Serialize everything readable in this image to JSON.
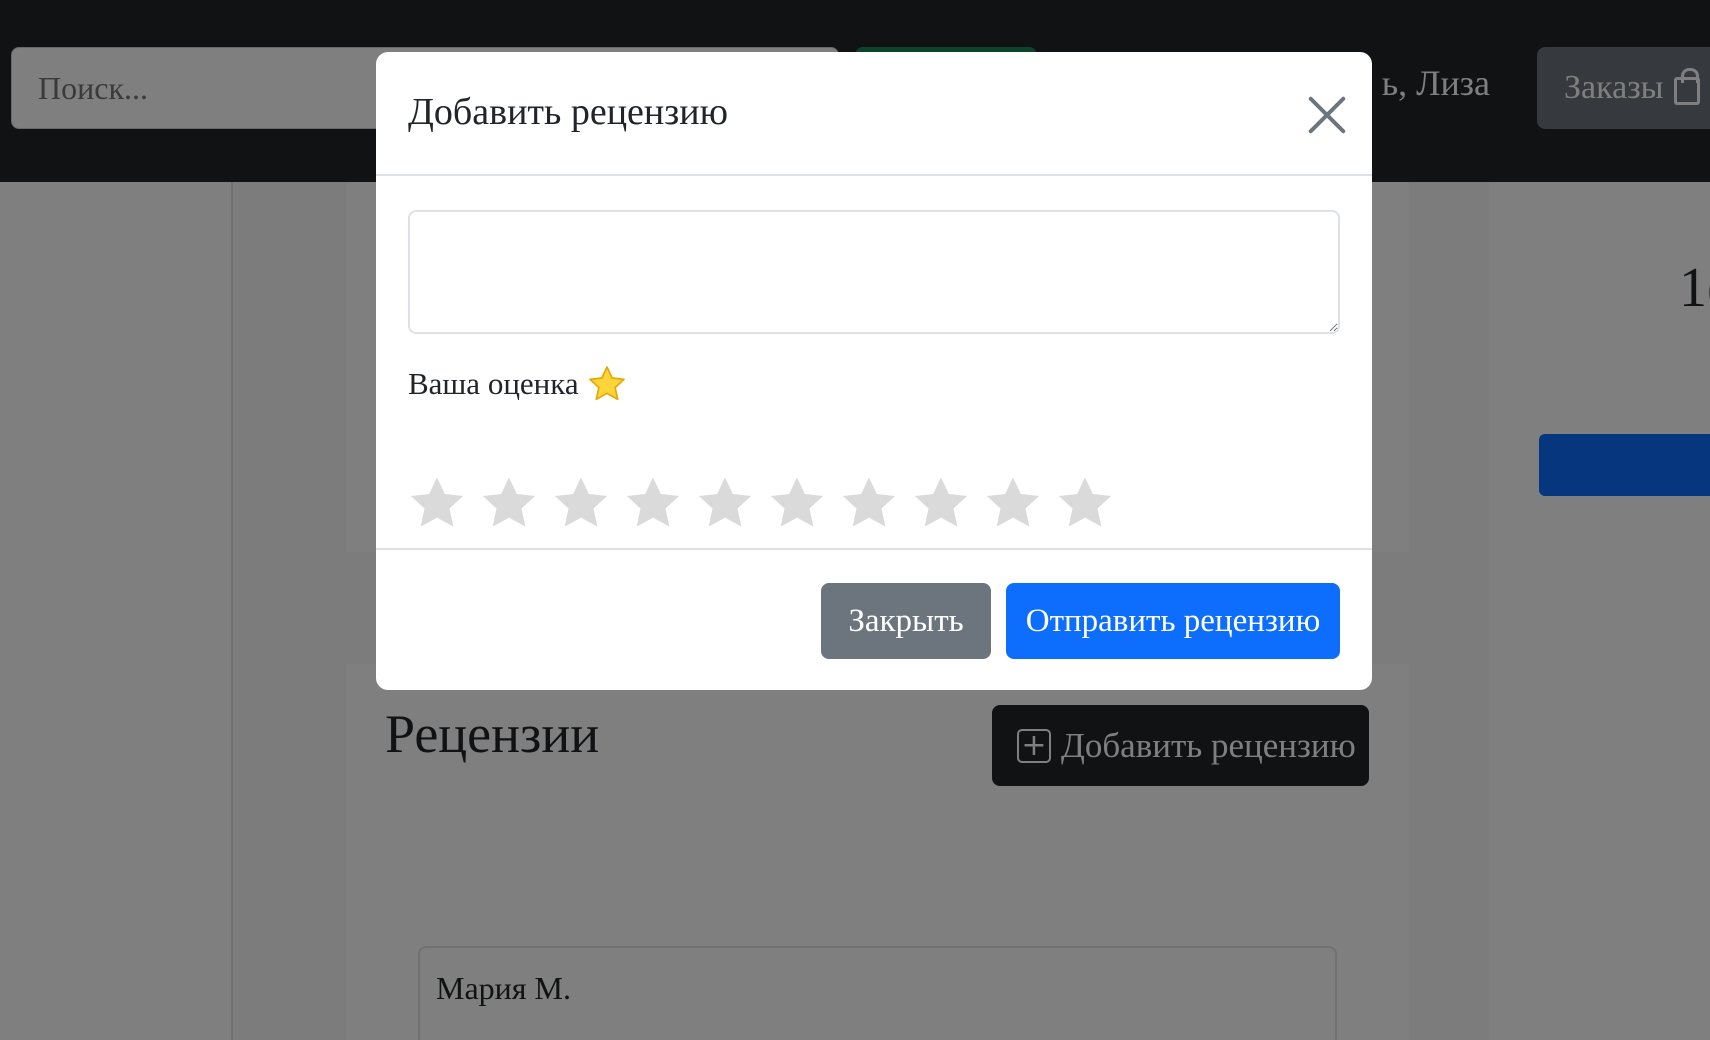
{
  "header": {
    "search_placeholder": "Поиск...",
    "greeting": "ь, Лиза",
    "orders_label": "Заказы"
  },
  "product": {
    "price_partial": "1("
  },
  "reviews": {
    "title": "Рецензии",
    "add_button_label": "Добавить рецензию",
    "items": [
      {
        "author": "Мария М."
      }
    ]
  },
  "modal": {
    "title": "Добавить рецензию",
    "textarea_value": "",
    "rating_label": "Ваша оценка",
    "rating_max": 10,
    "rating_value": 0,
    "star_color_empty": "#dadada",
    "close_label": "Закрыть",
    "submit_label": "Отправить рецензию"
  },
  "colors": {
    "primary": "#0d6efd",
    "secondary": "#6c757d",
    "dark": "#212529",
    "success": "#198754"
  }
}
